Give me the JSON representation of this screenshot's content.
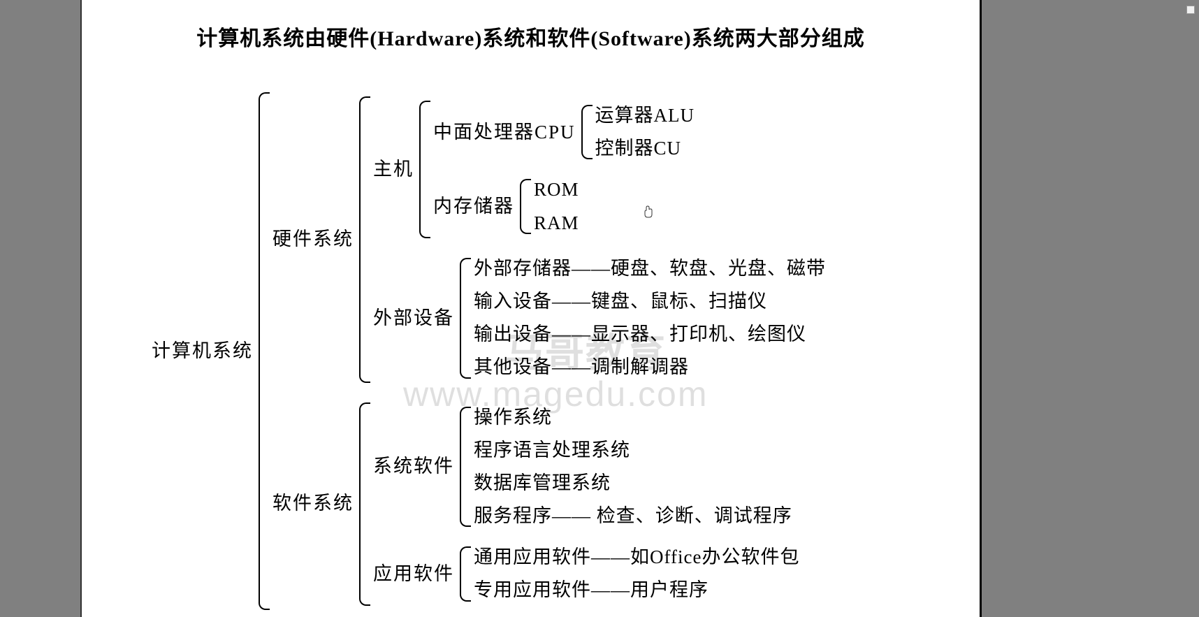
{
  "title": "计算机系统由硬件(Hardware)系统和软件(Software)系统两大部分组成",
  "watermark": {
    "line1": "马哥教育",
    "line2": "www.magedu.com"
  },
  "tree": {
    "root": "计算机系统",
    "hardware": {
      "label": "硬件系统",
      "host": {
        "label": "主机",
        "cpu": {
          "label": "中面处理器CPU",
          "items": [
            "运算器ALU",
            "控制器CU"
          ]
        },
        "memory": {
          "label": "内存储器",
          "items": [
            "ROM",
            "RAM"
          ]
        }
      },
      "external": {
        "label": "外部设备",
        "items": [
          "外部存储器——硬盘、软盘、光盘、磁带",
          "输入设备——键盘、鼠标、扫描仪",
          "输出设备——显示器、打印机、绘图仪",
          "其他设备——调制解调器"
        ]
      }
    },
    "software": {
      "label": "软件系统",
      "system": {
        "label": "系统软件",
        "items": [
          "操作系统",
          "程序语言处理系统",
          "数据库管理系统",
          "服务程序—— 检查、诊断、调试程序"
        ]
      },
      "application": {
        "label": "应用软件",
        "items": [
          "通用应用软件——如Office办公软件包",
          "专用应用软件——用户程序"
        ]
      }
    }
  }
}
